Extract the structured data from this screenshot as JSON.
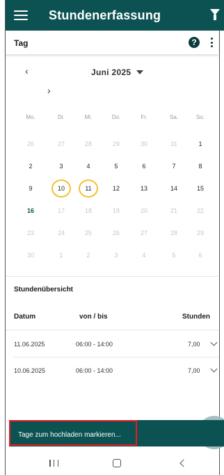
{
  "header": {
    "title": "Stundenerfassung",
    "menu_icon": "menu-icon",
    "filter_icon": "filter-icon"
  },
  "toolbar": {
    "title": "Tag",
    "help_icon": "help-icon",
    "help_glyph": "?",
    "more_icon": "more-vert-icon"
  },
  "calendar": {
    "month": "Juni 2025",
    "prev_glyph": "‹",
    "next_glyph": "›",
    "weekdays": [
      "Mo.",
      "Di.",
      "Mi.",
      "Do.",
      "Fr.",
      "Sa.",
      "So."
    ],
    "weeks": [
      [
        {
          "d": "26",
          "s": "muted"
        },
        {
          "d": "27",
          "s": "muted"
        },
        {
          "d": "28",
          "s": "muted"
        },
        {
          "d": "29",
          "s": "muted"
        },
        {
          "d": "30",
          "s": "muted"
        },
        {
          "d": "31",
          "s": "muted"
        },
        {
          "d": "1",
          "s": "normal"
        }
      ],
      [
        {
          "d": "2",
          "s": "normal"
        },
        {
          "d": "3",
          "s": "normal"
        },
        {
          "d": "4",
          "s": "normal"
        },
        {
          "d": "5",
          "s": "normal"
        },
        {
          "d": "6",
          "s": "normal"
        },
        {
          "d": "7",
          "s": "normal"
        },
        {
          "d": "8",
          "s": "normal"
        }
      ],
      [
        {
          "d": "9",
          "s": "normal"
        },
        {
          "d": "10",
          "s": "selected"
        },
        {
          "d": "11",
          "s": "selected"
        },
        {
          "d": "12",
          "s": "normal"
        },
        {
          "d": "13",
          "s": "normal"
        },
        {
          "d": "14",
          "s": "normal"
        },
        {
          "d": "15",
          "s": "normal"
        }
      ],
      [
        {
          "d": "16",
          "s": "today"
        },
        {
          "d": "17",
          "s": "muted"
        },
        {
          "d": "18",
          "s": "muted"
        },
        {
          "d": "19",
          "s": "muted"
        },
        {
          "d": "20",
          "s": "muted"
        },
        {
          "d": "21",
          "s": "muted"
        },
        {
          "d": "22",
          "s": "muted"
        }
      ],
      [
        {
          "d": "23",
          "s": "muted"
        },
        {
          "d": "24",
          "s": "muted"
        },
        {
          "d": "25",
          "s": "muted"
        },
        {
          "d": "26",
          "s": "muted"
        },
        {
          "d": "27",
          "s": "muted"
        },
        {
          "d": "28",
          "s": "muted"
        },
        {
          "d": "29",
          "s": "muted"
        }
      ],
      [
        {
          "d": "30",
          "s": "muted"
        },
        {
          "d": "1",
          "s": "muted"
        },
        {
          "d": "2",
          "s": "muted"
        },
        {
          "d": "3",
          "s": "muted"
        },
        {
          "d": "4",
          "s": "muted"
        },
        {
          "d": "5",
          "s": "muted"
        },
        {
          "d": "6",
          "s": "muted"
        }
      ]
    ]
  },
  "overview": {
    "title": "Stundenübersicht",
    "columns": {
      "date": "Datum",
      "range": "von / bis",
      "hours": "Stunden"
    },
    "rows": [
      {
        "date": "11.06.2025",
        "range": "06:00 - 14:00",
        "hours": "7,00"
      },
      {
        "date": "10.06.2025",
        "range": "06:00 - 14:00",
        "hours": "7,00"
      }
    ]
  },
  "snackbar": {
    "text": "Tage zum hochladen markieren..."
  },
  "colors": {
    "primary": "#0d5253",
    "selected_ring": "#f2c230",
    "highlight": "#ea1c1c"
  }
}
